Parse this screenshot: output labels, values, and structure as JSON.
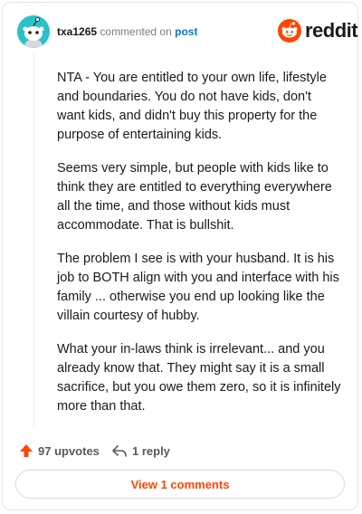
{
  "header": {
    "username": "txa1265",
    "action_text": "commented on",
    "post_link": "post",
    "brand": "reddit"
  },
  "comment": {
    "paragraphs": [
      "NTA - You are entitled to your own life, lifestyle and boundaries. You do not have kids, don't want kids, and didn't buy this property for the purpose of entertaining kids.",
      "Seems very simple, but people with kids like to think they are entitled to everything everywhere all the time, and those without kids must accommodate. That is bullshit.",
      "The problem I see is with your husband. It is his job to BOTH align with you and interface with his family ... otherwise you end up looking like the villain courtesy of hubby.",
      "What your in-laws think is irrelevant... and you already know that. They might say it is a small sacrifice, but you owe them zero, so it is infinitely more than that."
    ]
  },
  "actions": {
    "upvotes": "97 upvotes",
    "replies": "1 reply",
    "view_comments": "View 1 comments"
  },
  "colors": {
    "accent": "#ff4500",
    "link": "#0079d3",
    "avatar_bg": "#2ac2c8"
  },
  "icons": {
    "avatar": "snoo-avatar",
    "brand": "reddit-logo-icon",
    "upvote": "upvote-arrow-icon",
    "reply": "reply-arrow-icon"
  }
}
